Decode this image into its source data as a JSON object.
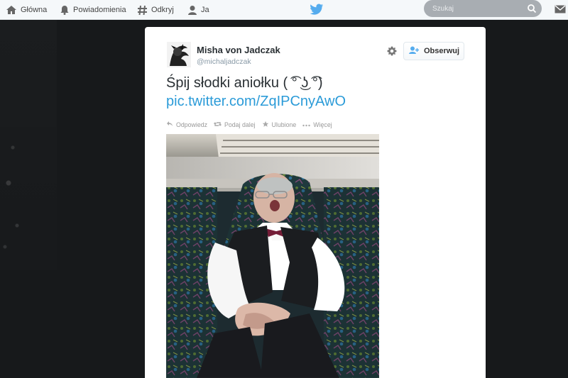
{
  "nav": {
    "home_label": "Główna",
    "notifications_label": "Powiadomienia",
    "discover_label": "Odkryj",
    "me_label": "Ja"
  },
  "search": {
    "placeholder": "Szukaj"
  },
  "tweet": {
    "author_name": "Misha von Jadczak",
    "author_handle": "@michaljadczak",
    "follow_label": "Obserwuj",
    "text": "Śpij słodki aniołku ( ͡° ͜ʖ ͡°)",
    "link": "pic.twitter.com/ZqIPCnyAwO",
    "actions": {
      "reply": "Odpowiedz",
      "retweet": "Podaj dalej",
      "favorite": "Ulubione",
      "more": "Więcej"
    }
  },
  "colors": {
    "twitter_blue": "#55acee",
    "link_blue": "#2b9bd8",
    "nav_text": "#444444",
    "background_dark": "#17191b",
    "card_white": "#ffffff"
  },
  "icons": {
    "home": "home-icon",
    "notifications": "bell-icon",
    "discover": "hashtag-icon",
    "me": "person-icon",
    "logo": "twitter-bird-icon",
    "search": "search-icon",
    "messages": "mail-icon",
    "settings": "gear-icon",
    "follow": "person-add-icon",
    "reply": "reply-icon",
    "retweet": "retweet-icon",
    "favorite": "star-icon",
    "more": "more-dots-icon"
  }
}
